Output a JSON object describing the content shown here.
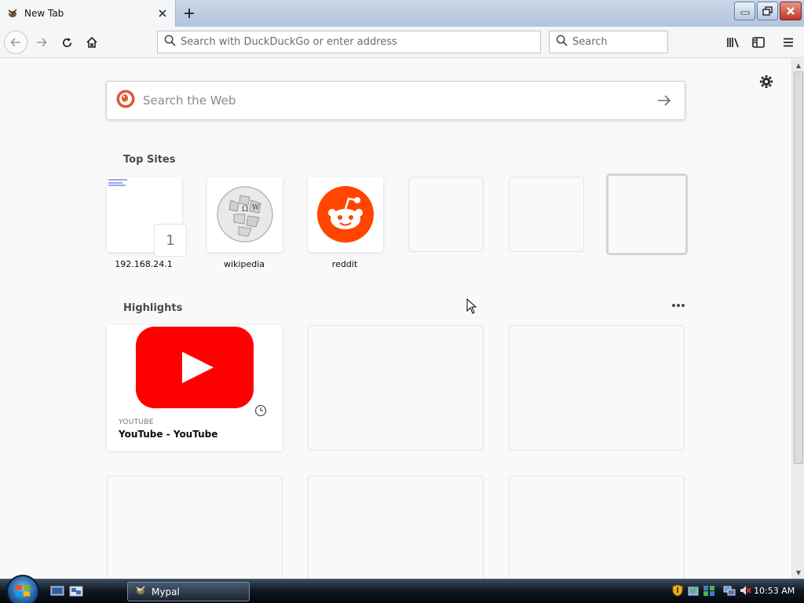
{
  "browser": {
    "tab_title": "New Tab",
    "url_placeholder": "Search with DuckDuckGo or enter address",
    "search_placeholder": "Search"
  },
  "newtab": {
    "web_search_placeholder": "Search the Web",
    "top_sites_title": "Top Sites",
    "top_sites": [
      {
        "label": "192.168.24.1",
        "badge": "1"
      },
      {
        "label": "wikipedia"
      },
      {
        "label": "reddit"
      }
    ],
    "highlights_title": "Highlights",
    "highlights": [
      {
        "host": "YOUTUBE",
        "title": "YouTube - YouTube"
      }
    ]
  },
  "taskbar": {
    "app_label": "Mypal",
    "time": "10:53 AM"
  },
  "colors": {
    "youtube_red": "#ff0000",
    "reddit_orange": "#ff4500",
    "duckduckgo_orange": "#de5833"
  }
}
